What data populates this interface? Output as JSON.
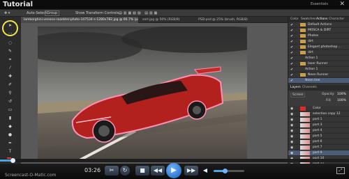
{
  "app": {
    "title": "Tutorial",
    "subtitle": "Essentials"
  },
  "options_bar": {
    "auto_select": "Auto-Select:",
    "group": "Group",
    "show_transform": "Show Transform Controls"
  },
  "doc_tabs": [
    {
      "label": "lamborghini-veneno-roadster-photo-147534-s-1280x782.jpg @ 66.7% (part 9, RGB/8)"
    },
    {
      "label": "sort.jpg @ 50% (RGB/8)"
    },
    {
      "label": "PSD-psd @ 25% (brush, RGB/8)"
    }
  ],
  "panels": {
    "top_tabs": [
      "Color",
      "Swatches",
      "Actions",
      "Character"
    ],
    "actions": [
      {
        "label": "Default Actions",
        "type": "folder"
      },
      {
        "label": "MOSCA & DIRT",
        "type": "folder"
      },
      {
        "label": "Photos",
        "type": "folder"
      },
      {
        "label": "dirt",
        "type": "folder"
      },
      {
        "label": "Elegant photoshop ...",
        "type": "folder"
      },
      {
        "label": "dirt",
        "type": "folder"
      },
      {
        "label": "Action 1",
        "type": "item"
      },
      {
        "label": "laser Runner",
        "type": "folder"
      },
      {
        "label": "Action 1",
        "type": "item"
      },
      {
        "label": "Neon Runner",
        "type": "folder"
      },
      {
        "label": "Neon line",
        "type": "item"
      }
    ],
    "layers_tabs": [
      "Layers",
      "Channels"
    ],
    "blend_mode": "Screen",
    "opacity_label": "Opacity:",
    "opacity_value": "100%",
    "fill_label": "Fill:",
    "fill_value": "100%",
    "layers": [
      {
        "label": "Color",
        "thumb": "red"
      },
      {
        "label": "selection copy 12"
      },
      {
        "label": "part 1"
      },
      {
        "label": "part 3"
      },
      {
        "label": "part 4"
      },
      {
        "label": "part 5"
      },
      {
        "label": "part 6"
      },
      {
        "label": "part 7"
      },
      {
        "label": "part 9",
        "selected": true
      },
      {
        "label": "part 10"
      },
      {
        "label": "part 11"
      },
      {
        "label": "part 12"
      }
    ]
  },
  "player": {
    "time": "03:26",
    "progress": 0.03,
    "volume": 0.36,
    "watermark": "Screencast-O-Matic.com"
  },
  "colors": {
    "accent": "#4fa3e0",
    "highlight_ring": "#f4e64a"
  }
}
